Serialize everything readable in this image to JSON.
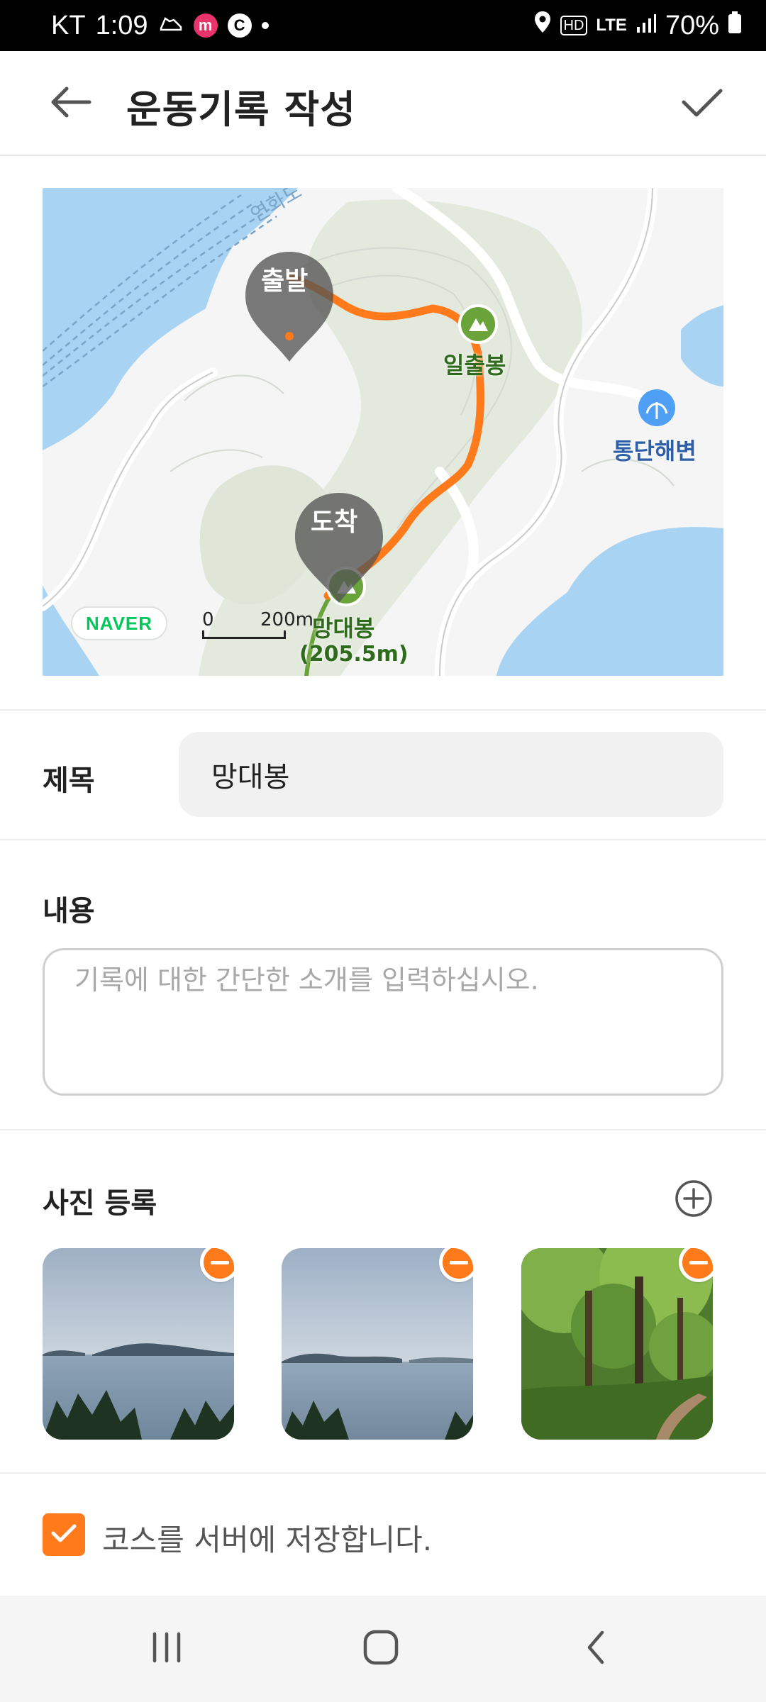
{
  "status_bar": {
    "carrier": "KT",
    "time": "1:09",
    "notif_m": "m",
    "notif_c": "C",
    "hd": "HD",
    "network": "LTE",
    "battery": "70%"
  },
  "header": {
    "title": "운동기록 작성",
    "back_icon": "arrow-left-icon",
    "confirm_icon": "check-icon"
  },
  "map": {
    "road_label": "연화도",
    "start_marker": "출발",
    "end_marker": "도착",
    "peak_1": "일출봉",
    "peak_2_name": "망대봉",
    "peak_2_height": "(205.5m)",
    "beach": "통단해변",
    "logo": "NAVER",
    "scale_zero": "0",
    "scale_distance": "200m",
    "colors": {
      "route": "#ff7a1a",
      "trail": "#6aa33a",
      "sea": "#a9d3f2",
      "land": "#f4f5f4",
      "forest": "#e3e9dc"
    }
  },
  "form": {
    "title_label": "제목",
    "title_value": "망대봉",
    "content_label": "내용",
    "content_placeholder": "기록에 대한 간단한 소개를 입력하십시오.",
    "photos_label": "사진 등록",
    "photos": [
      {
        "name": "sea-islands-view-1"
      },
      {
        "name": "sea-islands-view-2"
      },
      {
        "name": "forest-trail"
      }
    ],
    "save_course_label": "코스를 서버에 저장합니다.",
    "save_course_checked": true
  },
  "accent_color": "#ff7a1a"
}
